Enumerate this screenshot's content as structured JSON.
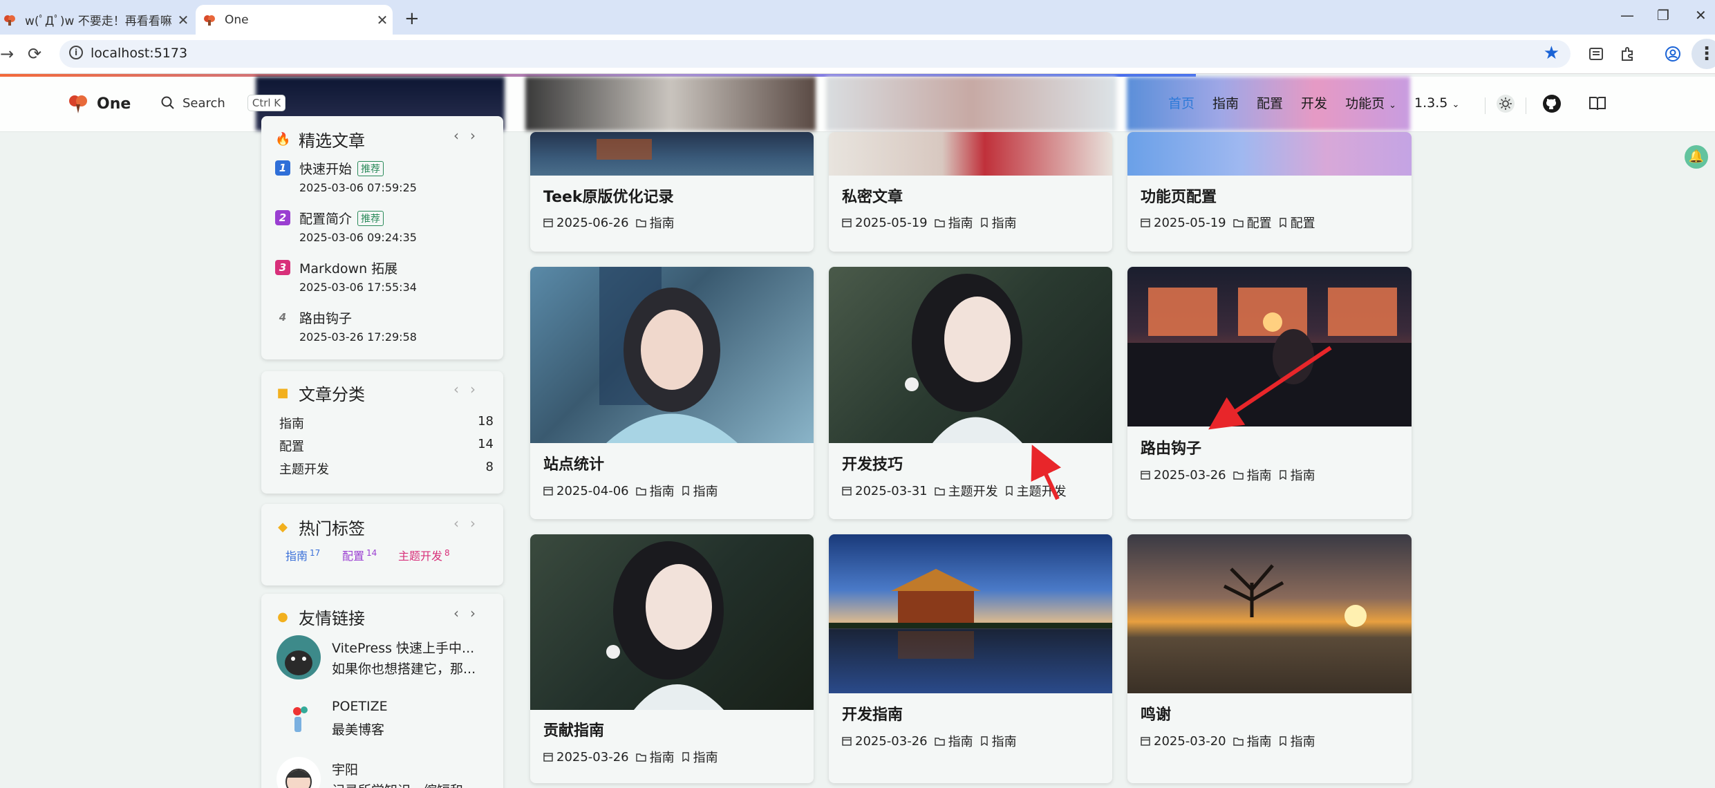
{
  "browser": {
    "tabs": [
      {
        "title": "w(ﾟДﾟ)w 不要走！再看看嘛！",
        "active": false
      },
      {
        "title": "One",
        "active": true
      }
    ],
    "url": "localhost:5173"
  },
  "header": {
    "logo_text": "One",
    "search_label": "Search",
    "search_shortcut": "Ctrl K",
    "nav": [
      {
        "label": "首页",
        "active": true
      },
      {
        "label": "指南",
        "active": false
      },
      {
        "label": "配置",
        "active": false
      },
      {
        "label": "开发",
        "active": false
      },
      {
        "label": "功能页",
        "active": false,
        "dropdown": true
      },
      {
        "label": "1.3.5",
        "active": false,
        "dropdown": true
      }
    ]
  },
  "sidebar": {
    "featured": {
      "title": "精选文章",
      "items": [
        {
          "rank": "1",
          "title": "快速开始",
          "badge": "推荐",
          "date": "2025-03-06 07:59:25",
          "color": "#2f6fd8"
        },
        {
          "rank": "2",
          "title": "配置简介",
          "badge": "推荐",
          "date": "2025-03-06 09:24:35",
          "color": "#9a3fd1"
        },
        {
          "rank": "3",
          "title": "Markdown 拓展",
          "badge": "",
          "date": "2025-03-06 17:55:34",
          "color": "#d8307a"
        },
        {
          "rank": "4",
          "title": "路由钩子",
          "badge": "",
          "date": "2025-03-26 17:29:58",
          "color": ""
        }
      ]
    },
    "categories": {
      "title": "文章分类",
      "items": [
        {
          "name": "指南",
          "count": "18"
        },
        {
          "name": "配置",
          "count": "14"
        },
        {
          "name": "主题开发",
          "count": "8"
        }
      ]
    },
    "tags": {
      "title": "热门标签",
      "items": [
        {
          "name": "指南",
          "count": "17",
          "color": "#3a6fd8"
        },
        {
          "name": "配置",
          "count": "14",
          "color": "#9a3fd1"
        },
        {
          "name": "主题开发",
          "count": "8",
          "color": "#d8307a"
        }
      ]
    },
    "friends": {
      "title": "友情链接",
      "items": [
        {
          "name": "VitePress 快速上手中...",
          "desc": "如果你也想搭建它，那..."
        },
        {
          "name": "POETIZE",
          "desc": "最美博客"
        },
        {
          "name": "宇阳",
          "desc": "记录所学知识，缩短和..."
        }
      ]
    }
  },
  "posts": [
    {
      "title": "Teek原版优化记录",
      "date": "2025-06-26",
      "category": "指南",
      "tag": ""
    },
    {
      "title": "私密文章",
      "date": "2025-05-19",
      "category": "指南",
      "tag": "指南"
    },
    {
      "title": "功能页配置",
      "date": "2025-05-19",
      "category": "配置",
      "tag": "配置"
    },
    {
      "title": "站点统计",
      "date": "2025-04-06",
      "category": "指南",
      "tag": "指南"
    },
    {
      "title": "开发技巧",
      "date": "2025-03-31",
      "category": "主题开发",
      "tag": "主题开发"
    },
    {
      "title": "路由钩子",
      "date": "2025-03-26",
      "category": "指南",
      "tag": "指南"
    },
    {
      "title": "贡献指南",
      "date": "2025-03-26",
      "category": "指南",
      "tag": "指南"
    },
    {
      "title": "开发指南",
      "date": "2025-03-26",
      "category": "指南",
      "tag": "指南"
    },
    {
      "title": "鸣谢",
      "date": "2025-03-20",
      "category": "指南",
      "tag": "指南"
    }
  ],
  "colors": {
    "accent": "#2f7ad8",
    "background": "#eef3f1",
    "annotation_arrow": "#e8262a"
  }
}
